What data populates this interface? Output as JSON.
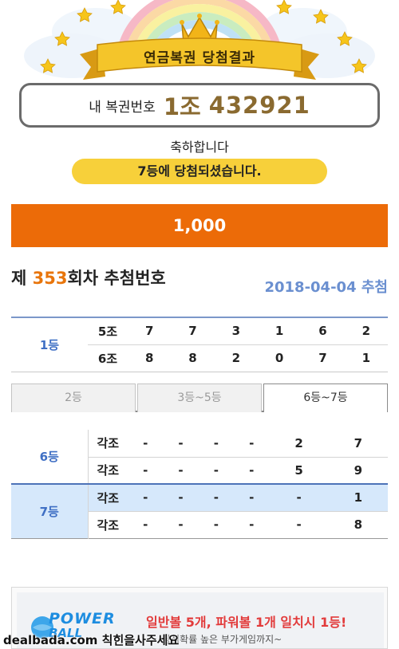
{
  "header": {
    "ribbon_title": "연금복권 당첨결과"
  },
  "ticket": {
    "label": "내 복권번호",
    "group": "1조",
    "number": "432921"
  },
  "result": {
    "congrats": "축하합니다",
    "rank_message": "7등에 당첨되셨습니다.",
    "prize_amount": "1,000"
  },
  "round": {
    "prefix": "제 ",
    "number": "353",
    "suffix": "회차 추첨번호",
    "date": "2018-04-04 추첨"
  },
  "first_prize": {
    "rank": "1등",
    "rows": [
      {
        "group": "5조",
        "digits": [
          "7",
          "7",
          "3",
          "1",
          "6",
          "2"
        ]
      },
      {
        "group": "6조",
        "digits": [
          "8",
          "8",
          "2",
          "0",
          "7",
          "1"
        ]
      }
    ]
  },
  "tabs": [
    "2등",
    "3등~5등",
    "6등~7등"
  ],
  "active_tab": "6등~7등",
  "lower_prizes": [
    {
      "rank": "6등",
      "highlight": false,
      "rows": [
        {
          "group": "각조",
          "digits": [
            "-",
            "-",
            "-",
            "-",
            "2",
            "7"
          ]
        },
        {
          "group": "각조",
          "digits": [
            "-",
            "-",
            "-",
            "-",
            "5",
            "9"
          ]
        }
      ]
    },
    {
      "rank": "7등",
      "highlight": true,
      "rows": [
        {
          "group": "각조",
          "digits": [
            "-",
            "-",
            "-",
            "-",
            "-",
            "1"
          ]
        },
        {
          "group": "각조",
          "digits": [
            "-",
            "-",
            "-",
            "-",
            "-",
            "8"
          ]
        }
      ]
    }
  ],
  "ad": {
    "logo_line1": "POWER",
    "logo_line2": "BALL",
    "headline": "일반볼 5개, 파워볼 1개 일치시 1등!",
    "subline": "당첨확률 높은 부가게임까지~"
  },
  "watermark": "dealbada.com 칙힌을사주세요",
  "colors": {
    "accent_orange": "#ec6b08",
    "pill_yellow": "#f7d03a",
    "rank_blue": "#3f6fc4",
    "date_blue": "#6a8fd0",
    "highlight_row": "#d6e8fb",
    "ticket_number": "#8a6a30"
  }
}
